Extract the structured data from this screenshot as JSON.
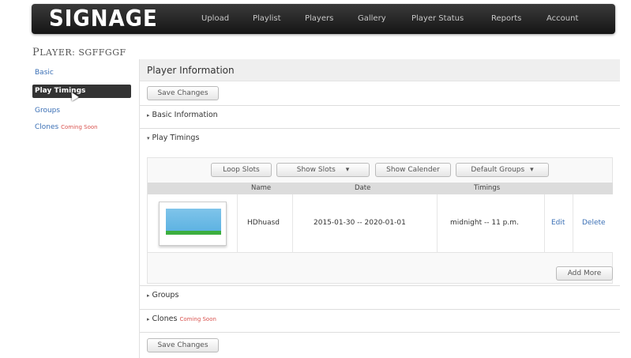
{
  "header": {
    "logo": "SIGNAGE",
    "nav": [
      "Upload",
      "Playlist",
      "Players",
      "Gallery",
      "Player Status",
      "Reports",
      "Account"
    ]
  },
  "page": {
    "title_prefix": "P",
    "title_rest": "LAYER: SGFFGGF"
  },
  "sidebar": {
    "items": [
      {
        "label": "Basic"
      },
      {
        "label": "Play Timings"
      },
      {
        "label": "Groups"
      },
      {
        "label": "Clones",
        "badge": "Coming Soon"
      }
    ]
  },
  "main": {
    "header": "Player Information",
    "save_label": "Save Changes",
    "sections": {
      "basic": "Basic Information",
      "play_timings": "Play Timings",
      "groups": "Groups",
      "clones": "Clones",
      "clones_badge": "Coming Soon"
    },
    "toolbar": {
      "loop_slots": "Loop Slots",
      "show_slots": "Show Slots",
      "show_calender": "Show Calender",
      "default_groups": "Default Groups"
    },
    "table": {
      "columns": [
        "Name",
        "Date",
        "Timings"
      ],
      "rows": [
        {
          "name": "HDhuasd",
          "date": "2015-01-30 -- 2020-01-01",
          "timings": "midnight -- 11 p.m.",
          "edit": "Edit",
          "delete": "Delete"
        }
      ]
    },
    "add_more": "Add More"
  }
}
